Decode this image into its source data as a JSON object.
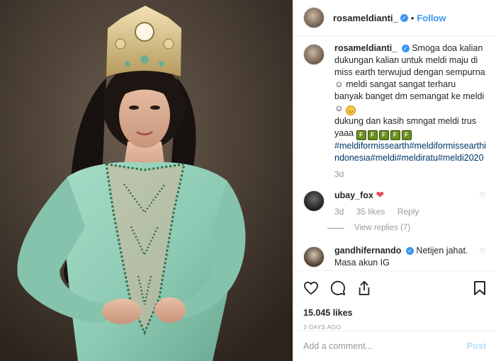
{
  "header": {
    "username": "rosameldianti_",
    "follow_label": "Follow"
  },
  "caption": {
    "username": "rosameldianti_",
    "text": "Smoga doa kalian dukungan kalian untuk meldi maju di miss earth terwujud dengan sempurna ☺ meldi sangat sangat terharu banyak banget dm semangat ke meldi ☺",
    "text2": "dukung dan kasih smngat meldi trus yaaa",
    "hashtags": "#meldiformissearth#meldiformissearthindonesia#meldi#meldiratu#meldi2020",
    "time": "3d"
  },
  "comments": [
    {
      "username": "ubay_fox",
      "text": "",
      "time": "3d",
      "likes": "35 likes",
      "reply_label": "Reply",
      "view_replies": "View replies (7)"
    },
    {
      "username": "gandhifernando",
      "text": "Netijen jahat. Masa akun IG"
    }
  ],
  "actions": {
    "likes": "15.045 likes",
    "time_ago": "3 DAYS AGO"
  },
  "add_comment": {
    "placeholder": "Add a comment...",
    "post_label": "Post"
  },
  "colors": {
    "accent": "#3897f0",
    "hashtag": "#003569",
    "dress": "#8ccab3",
    "heart": "#ed4956"
  }
}
